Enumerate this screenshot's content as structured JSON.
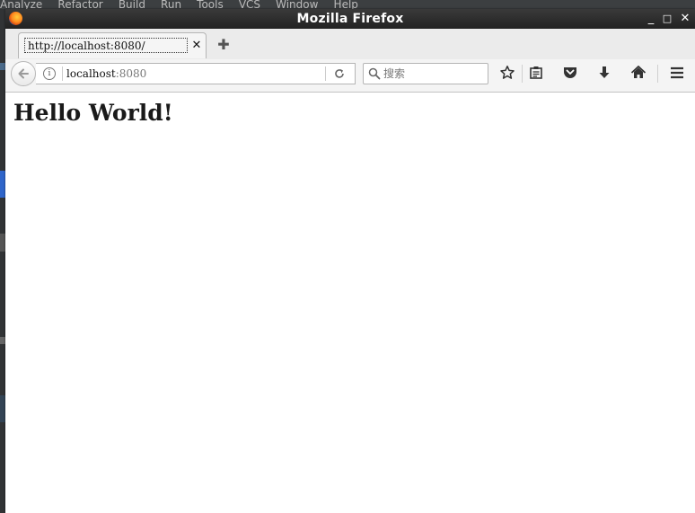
{
  "background_app": {
    "menu": [
      "Analyze",
      "Refactor",
      "Build",
      "Run",
      "Tools",
      "VCS",
      "Window",
      "Help"
    ]
  },
  "window": {
    "title": "Mozilla Firefox",
    "controls": {
      "minimize": "_",
      "maximize": "□",
      "close": "✕"
    }
  },
  "tabs": [
    {
      "label": "http://localhost:8080/",
      "close": "✕",
      "active": true
    }
  ],
  "new_tab": "✚",
  "navbar": {
    "url_host": "localhost",
    "url_port": ":8080",
    "search_placeholder": "搜索"
  },
  "page": {
    "heading": "Hello World!"
  },
  "icons": {
    "back": "back-arrow-icon",
    "info": "info-icon",
    "reload": "reload-icon",
    "search": "magnifier-icon",
    "bookmark": "star-icon",
    "reading_list": "clipboard-icon",
    "pocket": "pocket-icon",
    "downloads": "download-arrow-icon",
    "home": "home-icon",
    "menu": "hamburger-icon"
  },
  "colors": {
    "titlebar": "#2e2e2e",
    "toolbar": "#f4f4f4",
    "content_bg": "#ffffff"
  }
}
